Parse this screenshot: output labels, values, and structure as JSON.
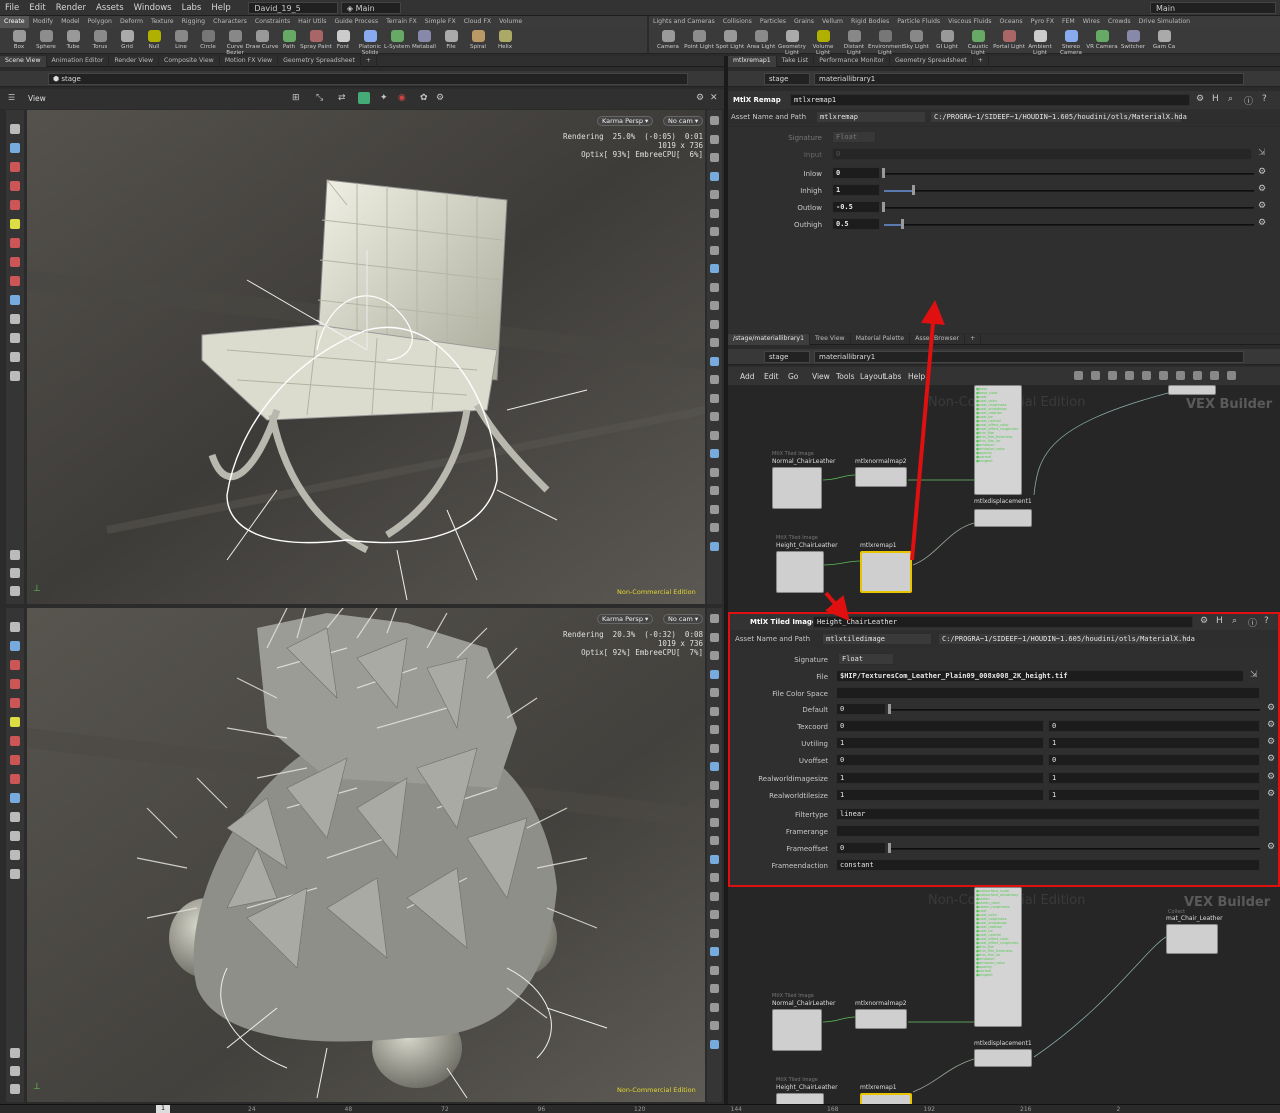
{
  "menu": {
    "items": [
      "File",
      "Edit",
      "Render",
      "Assets",
      "Windows",
      "Labs",
      "Help"
    ],
    "desktop": "David_19_5",
    "main": "Main",
    "right_main": "Main"
  },
  "shelf_left": {
    "tabs": [
      "Create",
      "Modify",
      "Model",
      "Polygon",
      "Deform",
      "Texture",
      "Rigging",
      "Characters",
      "Constraints",
      "Hair Utils",
      "Guide Process",
      "Terrain FX",
      "Simple FX",
      "Cloud FX",
      "Volume"
    ],
    "active": "Create",
    "tools": [
      "Box",
      "Sphere",
      "Tube",
      "Torus",
      "Grid",
      "Null",
      "Line",
      "Circle",
      "Curve Bezier",
      "Draw Curve",
      "Path",
      "Spray Paint",
      "Font",
      "Platonic Solids",
      "L-System",
      "Metaball",
      "File",
      "Spiral",
      "Helix"
    ]
  },
  "shelf_right": {
    "tabs": [
      "Lights and Cameras",
      "Collisions",
      "Particles",
      "Grains",
      "Vellum",
      "Rigid Bodies",
      "Particle Fluids",
      "Viscous Fluids",
      "Oceans",
      "Pyro FX",
      "FEM",
      "Wires",
      "Crowds",
      "Drive Simulation"
    ],
    "tools": [
      "Camera",
      "Point Light",
      "Spot Light",
      "Area Light",
      "Geometry Light",
      "Volume Light",
      "Distant Light",
      "Environment Light",
      "Sky Light",
      "GI Light",
      "Caustic Light",
      "Portal Light",
      "Ambient Light",
      "Stereo Camera",
      "VR Camera",
      "Switcher",
      "Gam Ca"
    ]
  },
  "left_pane": {
    "tabs": [
      "Scene View",
      "Animation Editor",
      "Render View",
      "Composite View",
      "Motion FX View",
      "Geometry Spreadsheet"
    ],
    "path": "stage",
    "view_label": "View"
  },
  "viewport_top": {
    "camera": "Karma Persp",
    "cam": "No cam",
    "hud": "Rendering  25.0%  (-0:05)  0:01\n1019 x 736\nOptix[ 93%] EmbreeCPU[  6%]",
    "nce": "Non-Commercial Edition"
  },
  "viewport_bottom": {
    "camera": "Karma Persp",
    "cam": "No cam",
    "hud": "Rendering  20.3%  (-0:32)  0:08\n1019 x 736\nOptix[ 92%] EmbreeCPU[  7%]",
    "nce": "Non-Commercial Edition"
  },
  "remap_pane": {
    "tabs": [
      "mtlxremap1",
      "Take List",
      "Performance Monitor",
      "Geometry Spreadsheet"
    ],
    "path1": "stage",
    "path2": "materiallibrary1",
    "node_type": "MtlX Remap",
    "node_name": "mtlxremap1",
    "asset_label": "Asset Name and Path",
    "asset_name": "mtlxremap",
    "asset_path": "C:/PROGRA~1/SIDEEF~1/HOUDIN~1.605/houdini/otls/MaterialX.hda",
    "params": [
      {
        "label": "Signature",
        "value": "Float"
      },
      {
        "label": "Input",
        "value": "0"
      },
      {
        "label": "Inlow",
        "value": "0"
      },
      {
        "label": "Inhigh",
        "value": "1"
      },
      {
        "label": "Outlow",
        "value": "-0.5"
      },
      {
        "label": "Outhigh",
        "value": "0.5"
      }
    ],
    "fills": {
      "inlow": 0,
      "inhigh": 0.08,
      "outlow": 0,
      "outhigh": 0.05
    }
  },
  "net_top": {
    "tabs": [
      "/stage/materiallibrary1",
      "Tree View",
      "Material Palette",
      "Asset Browser"
    ],
    "path1": "stage",
    "path2": "materiallibrary1",
    "menu": [
      "Add",
      "Edit",
      "Go",
      "View",
      "Tools",
      "Layout",
      "Labs",
      "Help"
    ],
    "watermark": "Non-Commercial Edition",
    "vex": "VEX Builder",
    "nodes": [
      {
        "title": "Normal_ChairLeather",
        "sub": "MtlX Tiled Image"
      },
      {
        "title": "mtlxnormalmap2",
        "sub": ""
      },
      {
        "title": "mtlxdisplacement1",
        "sub": ""
      },
      {
        "title": "Height_ChairLeather",
        "sub": "MtlX Tiled Image"
      },
      {
        "title": "mtlxremap1",
        "sub": ""
      }
    ]
  },
  "tiled_pane": {
    "node_type": "MtlX Tiled Image",
    "node_name": "Height_ChairLeather",
    "asset_label": "Asset Name and Path",
    "asset_name": "mtlxtiledimage",
    "asset_path": "C:/PROGRA~1/SIDEEF~1/HOUDIN~1.605/houdini/otls/MaterialX.hda",
    "signature_label": "Signature",
    "signature": "Float",
    "file_label": "File",
    "file": "$HIP/TexturesCom_Leather_Plain09_008x008_2K_height.tif",
    "fcs_label": "File Color Space",
    "default_label": "Default",
    "default": "0",
    "pairs": [
      {
        "label": "Texcoord",
        "a": "0",
        "b": "0"
      },
      {
        "label": "Uvtiling",
        "a": "1",
        "b": "1"
      },
      {
        "label": "Uvoffset",
        "a": "0",
        "b": "0"
      },
      {
        "label": "Realworldimagesize",
        "a": "1",
        "b": "1"
      },
      {
        "label": "Realworldtilesize",
        "a": "1",
        "b": "1"
      }
    ],
    "filtertype_label": "Filtertype",
    "filtertype": "linear",
    "framerange_label": "Framerange",
    "frameoffset_label": "Frameoffset",
    "frameoffset": "0",
    "frameendaction_label": "Frameendaction",
    "frameendaction": "constant"
  },
  "net_bottom": {
    "watermark": "Non-Commercial Edition",
    "vex": "VEX Builder",
    "mat_sub": "Collect",
    "mat_name": "mat_Chair_Leather",
    "nodes": [
      {
        "title": "Normal_ChairLeather",
        "sub": "MtlX Tiled Image"
      },
      {
        "title": "mtlxnormalmap2",
        "sub": ""
      },
      {
        "title": "mtlxdisplacement1",
        "sub": ""
      },
      {
        "title": "Height_ChairLeather",
        "sub": "MtlX Tiled Image"
      },
      {
        "title": "mtlxremap1",
        "sub": ""
      }
    ]
  },
  "timeline": {
    "frame": "1",
    "ticks": [
      "24",
      "48",
      "72",
      "96",
      "120",
      "144",
      "168",
      "192",
      "216",
      "2"
    ]
  },
  "colors": {
    "accent_red": "#e01010",
    "selected_yellow": "#e8c400",
    "nce_yellow": "#e5d62f"
  }
}
